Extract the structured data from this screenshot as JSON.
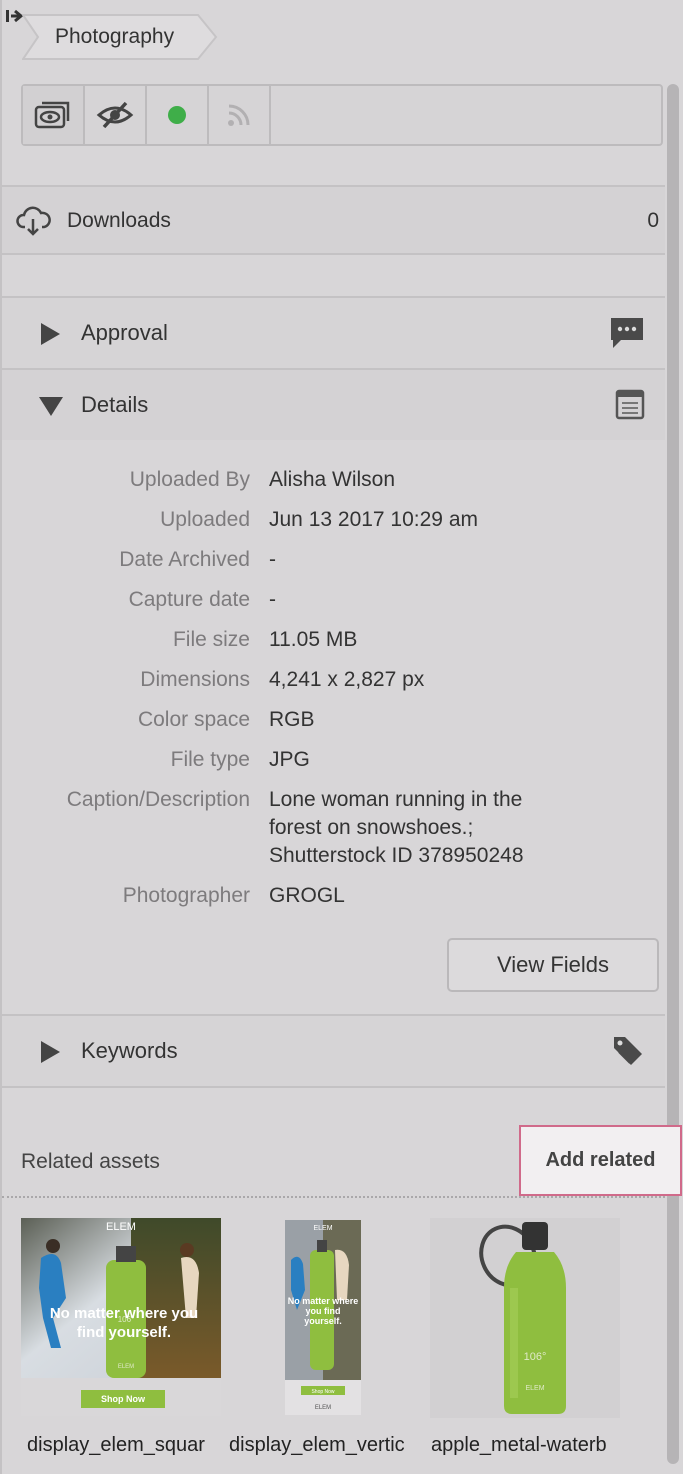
{
  "breadcrumb": {
    "label": "Photography"
  },
  "toolbar": {
    "buttons": [
      {
        "name": "views-icon"
      },
      {
        "name": "hidden-icon"
      },
      {
        "name": "status-dot-icon",
        "color": "#3fae49"
      },
      {
        "name": "rss-icon"
      }
    ]
  },
  "downloads": {
    "label": "Downloads",
    "count": "0"
  },
  "sections": {
    "approval": {
      "title": "Approval"
    },
    "details": {
      "title": "Details"
    },
    "keywords": {
      "title": "Keywords"
    }
  },
  "details": {
    "rows": [
      {
        "key": "Uploaded By",
        "value": "Alisha Wilson"
      },
      {
        "key": "Uploaded",
        "value": "Jun 13 2017 10:29 am"
      },
      {
        "key": "Date Archived",
        "value": "-"
      },
      {
        "key": "Capture date",
        "value": "-"
      },
      {
        "key": "File size",
        "value": "11.05 MB"
      },
      {
        "key": "Dimensions",
        "value": "4,241 x 2,827 px"
      },
      {
        "key": "Color space",
        "value": "RGB"
      },
      {
        "key": "File type",
        "value": "JPG"
      },
      {
        "key": "Caption/Description",
        "value": "Lone woman running in the\nforest on snowshoes.;\nShutterstock ID 378950248"
      },
      {
        "key": "Photographer",
        "value": "GROGL"
      }
    ],
    "view_fields_label": "View Fields"
  },
  "related": {
    "label": "Related assets",
    "add_label": "Add related",
    "assets": [
      {
        "filename": "display_elem_squar",
        "headline": "No matter where you find yourself.",
        "logo": "ELEM",
        "cta": "Shop Now",
        "bottle_text": "106°",
        "brand": "ELEM"
      },
      {
        "filename": "display_elem_vertic",
        "headline": "No matter where you find yourself.",
        "logo": "ELEM",
        "cta": "Shop Now",
        "brand": "ELEM"
      },
      {
        "filename": "apple_metal-waterb",
        "bottle_text": "106°",
        "brand": "ELEM"
      }
    ]
  },
  "colors": {
    "accent_green": "#3fae49",
    "bottle_green": "#8fbe3f",
    "highlight_border": "#d06a8a"
  }
}
